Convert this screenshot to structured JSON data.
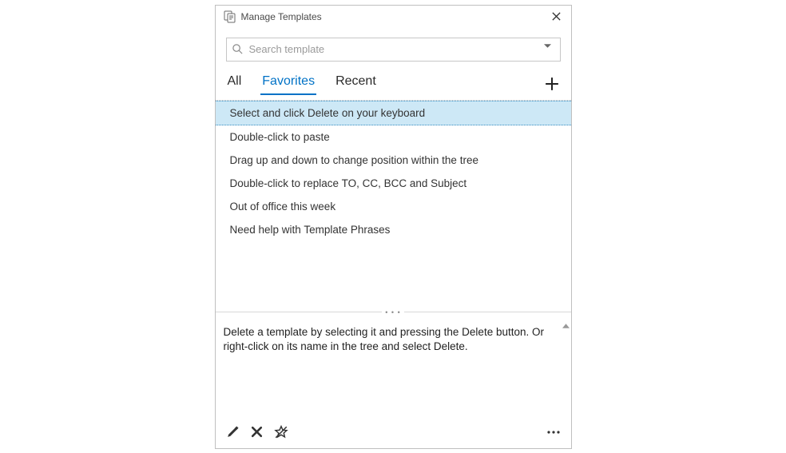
{
  "title": "Manage Templates",
  "search": {
    "placeholder": "Search template",
    "value": ""
  },
  "tabs": [
    {
      "label": "All",
      "active": false
    },
    {
      "label": "Favorites",
      "active": true
    },
    {
      "label": "Recent",
      "active": false
    }
  ],
  "items": [
    {
      "label": "Select and click Delete on your keyboard",
      "selected": true
    },
    {
      "label": "Double-click to paste",
      "selected": false
    },
    {
      "label": "Drag up and down to change position within the tree",
      "selected": false
    },
    {
      "label": "Double-click to replace TO, CC, BCC and Subject",
      "selected": false
    },
    {
      "label": "Out of office this week",
      "selected": false
    },
    {
      "label": "Need help with Template Phrases",
      "selected": false
    }
  ],
  "preview_text": "Delete a template by selecting it and pressing the Delete button. Or right-click on its name in the tree and select Delete.",
  "icons": {
    "app": "templates-icon",
    "close": "close-icon",
    "search": "search-icon",
    "dropdown": "chevron-down-icon",
    "add": "plus-icon",
    "edit": "pencil-icon",
    "delete": "delete-x-icon",
    "unfavorite": "star-off-icon",
    "more": "more-dots-icon"
  }
}
